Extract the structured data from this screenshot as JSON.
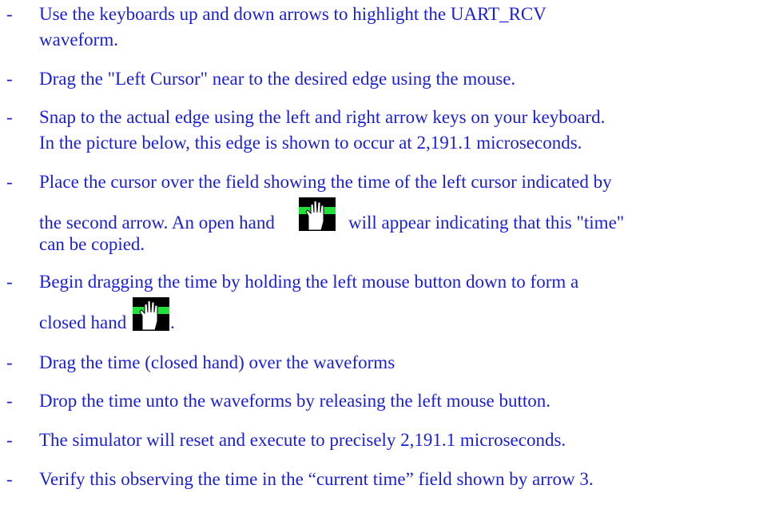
{
  "bullet": "-",
  "steps": [
    {
      "lines": [
        "Use the keyboards up and down arrows to highlight the UART_RCV",
        "waveform."
      ]
    },
    {
      "lines": [
        "Drag the \"Left Cursor\" near to the desired edge using the mouse."
      ]
    },
    {
      "lines": [
        "Snap to the actual edge using the left and right arrow keys on your keyboard.",
        "In the picture below, this edge is shown to occur at 2,191.1 microseconds."
      ]
    },
    {
      "line1": "Place the cursor over the field showing the time of the left cursor indicated by",
      "line2_before": "the second arrow.  An open hand",
      "line2_after": "will appear indicating that this \"time\"",
      "line3": "can be copied.",
      "icon": "open-hand-icon"
    },
    {
      "line1": "Begin dragging the time by holding the left mouse button down to form a",
      "line2_before": "closed hand",
      "line2_after": ".",
      "icon": "closed-hand-icon"
    },
    {
      "lines": [
        "Drag the time (closed hand) over the waveforms"
      ]
    },
    {
      "lines": [
        "Drop the time unto the waveforms by releasing the left mouse button."
      ]
    },
    {
      "lines": [
        "The simulator will reset and execute to precisely 2,191.1 microseconds."
      ]
    },
    {
      "lines": [
        "Verify this observing the time in the “current time” field shown by arrow 3."
      ]
    }
  ],
  "colors": {
    "text": "#1a1fd6",
    "icon_bg": "#000000",
    "icon_hand": "#ffffff",
    "icon_bar": "#22e03a"
  }
}
